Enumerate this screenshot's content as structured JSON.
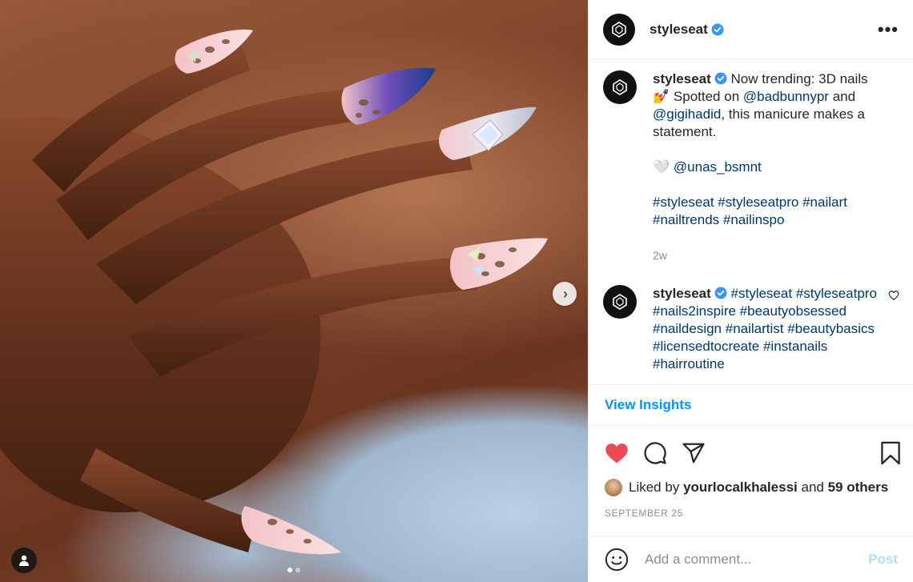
{
  "post": {
    "username": "styleseat",
    "more_label": "•••"
  },
  "caption": {
    "username": "styleseat",
    "text_1": "Now trending: 3D nails 💅",
    "text_2": "Spotted on",
    "mention_1": "@badbunnypr",
    "text_3": "and",
    "mention_2": "@gigihadid",
    "text_4": ", this manicure makes a statement.",
    "credit_emoji": "🤍",
    "mention_3": "@unas_bsmnt",
    "hashtags": "#styleseat #styleseatpro #nailart #nailtrends #nailinspo",
    "age": "2w"
  },
  "comment": {
    "username": "styleseat",
    "text": "#styleseat #styleseatpro #nails2inspire #beautyobsessed #naildesign #nailartist #beautybasics #licensedtocreate #instanails #hairroutine"
  },
  "insights_label": "View Insights",
  "likes": {
    "prefix": "Liked by",
    "user": "yourlocalkhalessi",
    "mid": "and",
    "others": "59 others"
  },
  "date": "SEPTEMBER 25",
  "add_comment": {
    "placeholder": "Add a comment...",
    "post_label": "Post"
  },
  "carousel": {
    "dot_count": 2,
    "active_index": 0
  },
  "colors": {
    "like_red": "#ed4956",
    "link_blue": "#00376b",
    "action_blue": "#0095f6",
    "verified_blue": "#3897f0"
  }
}
